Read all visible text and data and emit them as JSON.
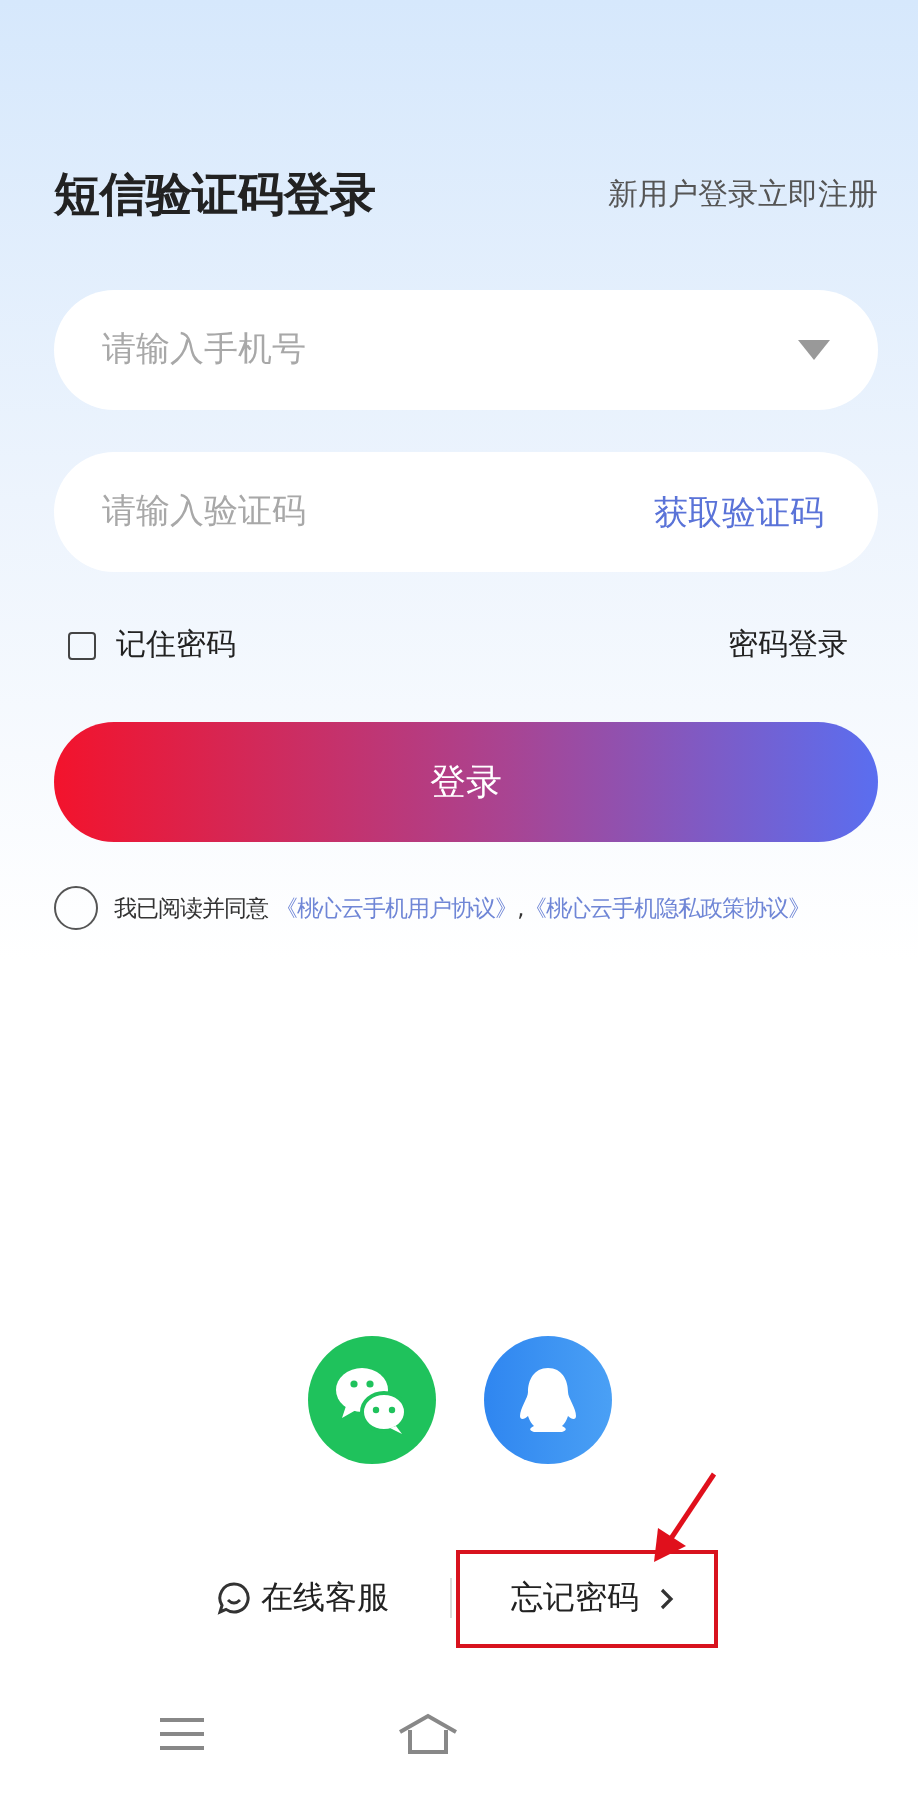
{
  "header": {
    "title": "短信验证码登录",
    "register_link": "新用户登录立即注册"
  },
  "phone_field": {
    "placeholder": "请输入手机号"
  },
  "code_field": {
    "placeholder": "请输入验证码",
    "action": "获取验证码"
  },
  "remember": {
    "label": "记住密码",
    "checked": false
  },
  "password_login": "密码登录",
  "login_button": "登录",
  "agreement": {
    "checked": false,
    "prefix": "我已阅读并同意",
    "links": [
      "《桃心云手机用户协议》",
      "《桃心云手机隐私政策协议》"
    ],
    "separator": ","
  },
  "social": [
    {
      "kind": "wechat"
    },
    {
      "kind": "qq"
    }
  ],
  "service": "在线客服",
  "forgot": {
    "label": "忘记密码",
    "highlighted": true
  }
}
